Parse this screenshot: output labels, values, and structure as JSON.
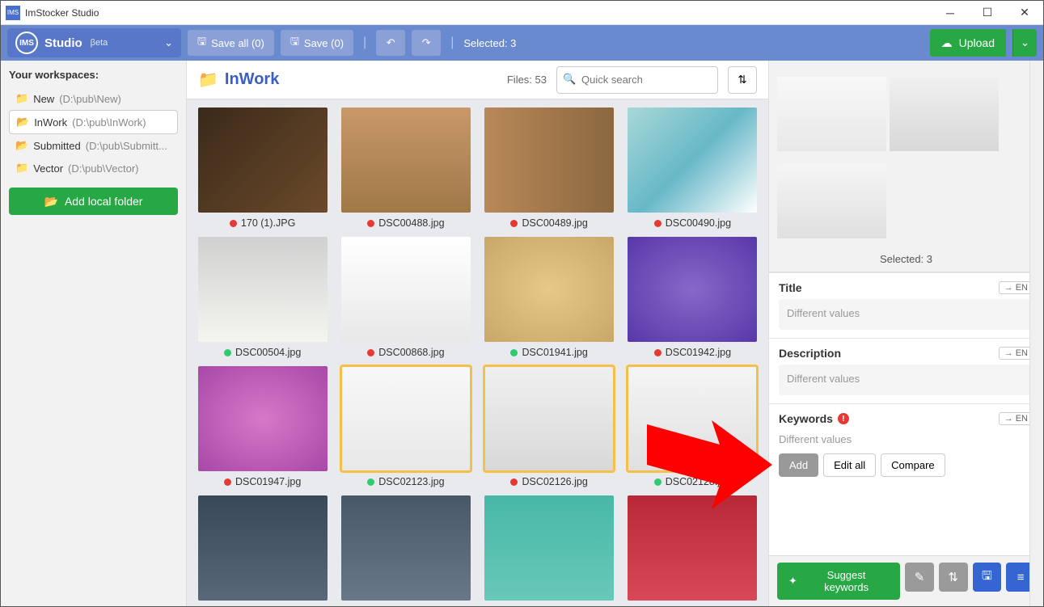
{
  "app_title": "ImStocker Studio",
  "brand": {
    "name": "Studio",
    "sub": "βeta"
  },
  "toolbar": {
    "save_all": "Save all (0)",
    "save": "Save (0)",
    "selected": "Selected: 3",
    "upload": "Upload"
  },
  "sidebar": {
    "title": "Your workspaces:",
    "items": [
      {
        "name": "New",
        "path": "(D:\\pub\\New)",
        "active": false,
        "icon": "folder"
      },
      {
        "name": "InWork",
        "path": "(D:\\pub\\InWork)",
        "active": true,
        "icon": "folder-open"
      },
      {
        "name": "Submitted",
        "path": "(D:\\pub\\Submitt...",
        "active": false,
        "icon": "folder-open"
      },
      {
        "name": "Vector",
        "path": "(D:\\pub\\Vector)",
        "active": false,
        "icon": "folder"
      }
    ],
    "add_folder": "Add local folder"
  },
  "center": {
    "folder": "InWork",
    "files_label": "Files: 53",
    "search_placeholder": "Quick search",
    "thumbs": [
      {
        "label": "170 (1).JPG",
        "status": "red",
        "sel": false,
        "bg": "bg1"
      },
      {
        "label": "DSC00488.jpg",
        "status": "red",
        "sel": false,
        "bg": "bg2"
      },
      {
        "label": "DSC00489.jpg",
        "status": "red",
        "sel": false,
        "bg": "bg3"
      },
      {
        "label": "DSC00490.jpg",
        "status": "red",
        "sel": false,
        "bg": "bg4"
      },
      {
        "label": "DSC00504.jpg",
        "status": "green",
        "sel": false,
        "bg": "bg5"
      },
      {
        "label": "DSC00868.jpg",
        "status": "red",
        "sel": false,
        "bg": "bg6"
      },
      {
        "label": "DSC01941.jpg",
        "status": "green",
        "sel": false,
        "bg": "bg7"
      },
      {
        "label": "DSC01942.jpg",
        "status": "red",
        "sel": false,
        "bg": "bg8"
      },
      {
        "label": "DSC01947.jpg",
        "status": "red",
        "sel": false,
        "bg": "bg9"
      },
      {
        "label": "DSC02123.jpg",
        "status": "green",
        "sel": true,
        "bg": "bg10"
      },
      {
        "label": "DSC02126.jpg",
        "status": "red",
        "sel": true,
        "bg": "bg11"
      },
      {
        "label": "DSC02128.jpg",
        "status": "green",
        "sel": true,
        "bg": "bg12"
      },
      {
        "label": "",
        "status": "",
        "sel": false,
        "bg": "bg13"
      },
      {
        "label": "",
        "status": "",
        "sel": false,
        "bg": "bg14"
      },
      {
        "label": "",
        "status": "",
        "sel": false,
        "bg": "bg15"
      },
      {
        "label": "",
        "status": "",
        "sel": false,
        "bg": "bg16"
      }
    ]
  },
  "right": {
    "selected_label": "Selected: 3",
    "title_label": "Title",
    "desc_label": "Description",
    "kw_label": "Keywords",
    "lang": "→ EN",
    "diff": "Different values",
    "add": "Add",
    "edit_all": "Edit all",
    "compare": "Compare",
    "suggest": "Suggest keywords"
  }
}
